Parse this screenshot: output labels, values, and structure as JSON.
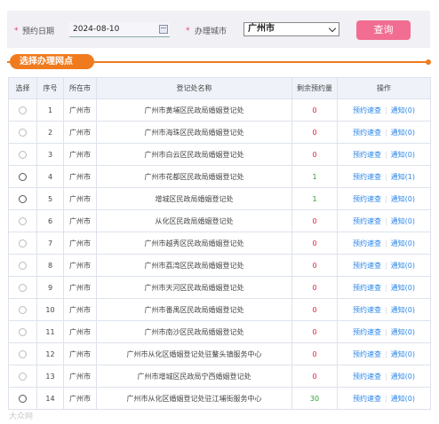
{
  "search": {
    "date_label": "预约日期",
    "date_value": "2024-08-10",
    "city_label": "办理城市",
    "city_value": "广州市",
    "query_label": "查询"
  },
  "section": {
    "title": "选择办理网点"
  },
  "table": {
    "headers": [
      "选择",
      "序号",
      "所在市",
      "登记处名称",
      "剩余预约量",
      "操作"
    ],
    "rows": [
      {
        "no": "1",
        "city": "广州市",
        "name": "广州市黄埔区民政局婚姻登记处",
        "remain": "0",
        "notify": "通知(0)",
        "active": false
      },
      {
        "no": "2",
        "city": "广州市",
        "name": "广州市海珠区民政局婚姻登记处",
        "remain": "0",
        "notify": "通知(0)",
        "active": false
      },
      {
        "no": "3",
        "city": "广州市",
        "name": "广州市白云区民政局婚姻登记处",
        "remain": "0",
        "notify": "通知(0)",
        "active": false
      },
      {
        "no": "4",
        "city": "广州市",
        "name": "广州市花都区民政局婚姻登记处",
        "remain": "1",
        "notify": "通知(1)",
        "active": true
      },
      {
        "no": "5",
        "city": "广州市",
        "name": "增城区民政局婚姻登记处",
        "remain": "1",
        "notify": "通知(0)",
        "active": true
      },
      {
        "no": "6",
        "city": "广州市",
        "name": "从化区民政局婚姻登记处",
        "remain": "0",
        "notify": "通知(0)",
        "active": false
      },
      {
        "no": "7",
        "city": "广州市",
        "name": "广州市越秀区民政局婚姻登记处",
        "remain": "0",
        "notify": "通知(0)",
        "active": false
      },
      {
        "no": "8",
        "city": "广州市",
        "name": "广州市荔湾区民政局婚姻登记处",
        "remain": "0",
        "notify": "通知(0)",
        "active": false
      },
      {
        "no": "9",
        "city": "广州市",
        "name": "广州市天河区民政局婚姻登记处",
        "remain": "0",
        "notify": "通知(0)",
        "active": false
      },
      {
        "no": "10",
        "city": "广州市",
        "name": "广州市番禺区民政局婚姻登记处",
        "remain": "0",
        "notify": "通知(0)",
        "active": false
      },
      {
        "no": "11",
        "city": "广州市",
        "name": "广州市南沙区民政局婚姻登记处",
        "remain": "0",
        "notify": "通知(0)",
        "active": false
      },
      {
        "no": "12",
        "city": "广州市",
        "name": "广州市从化区婚姻登记处驻鳌头镇服务中心",
        "remain": "0",
        "notify": "通知(0)",
        "active": false
      },
      {
        "no": "13",
        "city": "广州市",
        "name": "广州市增城区民政局宁西婚姻登记处",
        "remain": "0",
        "notify": "通知(0)",
        "active": false
      },
      {
        "no": "14",
        "city": "广州市",
        "name": "广州市从化区婚姻登记处驻江埔街服务中心",
        "remain": "30",
        "notify": "通知(0)",
        "active": true
      }
    ],
    "action_label": "预约速查"
  },
  "watermark": "大众网",
  "colors": {
    "accent": "#f07b1f",
    "button": "#f26d92",
    "link": "#2b86e6",
    "zero": "#e0203a",
    "available": "#2aa02a"
  }
}
